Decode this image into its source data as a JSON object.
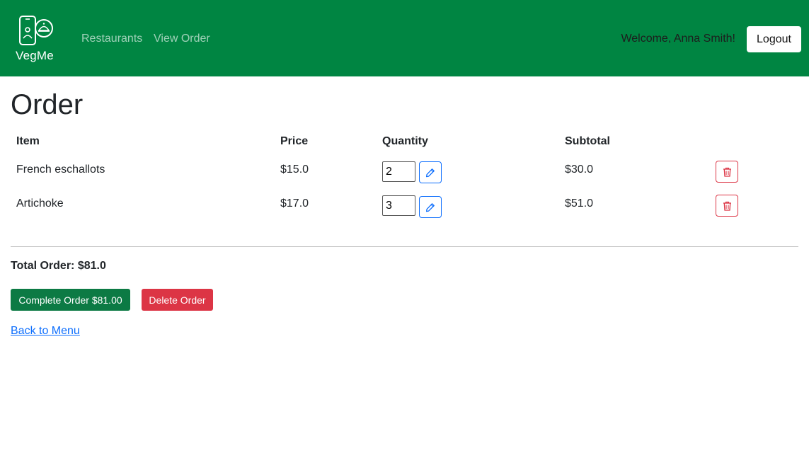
{
  "navbar": {
    "brand": "VegMe",
    "links": [
      "Restaurants",
      "View Order"
    ],
    "welcome": "Welcome, Anna Smith!",
    "logout_label": "Logout"
  },
  "page": {
    "title": "Order"
  },
  "table": {
    "headers": [
      "Item",
      "Price",
      "Quantity",
      "Subtotal"
    ],
    "rows": [
      {
        "item": "French eschallots",
        "price": "$15.0",
        "quantity": "2",
        "subtotal": "$30.0"
      },
      {
        "item": "Artichoke",
        "price": "$17.0",
        "quantity": "3",
        "subtotal": "$51.0"
      }
    ]
  },
  "summary": {
    "total": "Total Order: $81.0",
    "complete_label": "Complete Order $81.00",
    "delete_label": "Delete Order",
    "back_label": "Back to Menu"
  },
  "colors": {
    "navbar_bg": "#008542",
    "complete_btn": "#0c7a44",
    "delete_btn": "#dc3545",
    "edit_outline": "#0d6efd",
    "link": "#0d6efd"
  },
  "icons": {
    "edit": "pencil-icon",
    "remove": "trash-icon",
    "logo": "phone-cloche-icon"
  }
}
